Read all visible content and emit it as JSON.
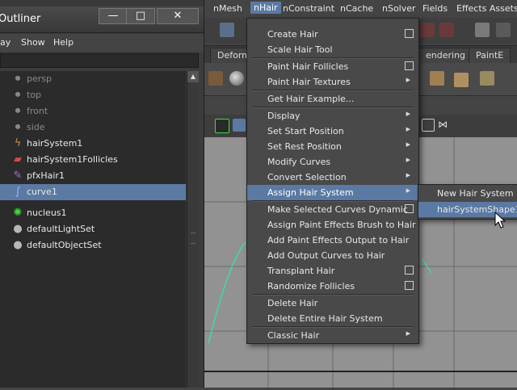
{
  "outliner": {
    "title": "Outliner",
    "window_buttons": {
      "minimize": "—",
      "maximize": "□",
      "close": "✕"
    },
    "menus": [
      "Display",
      "Show",
      "Help"
    ],
    "menus_visible": [
      "ay",
      "Show",
      "Help"
    ],
    "items": [
      {
        "label": "persp",
        "icon": "camera-icon",
        "dim": true
      },
      {
        "label": "top",
        "icon": "camera-icon",
        "dim": true
      },
      {
        "label": "front",
        "icon": "camera-icon",
        "dim": true
      },
      {
        "label": "side",
        "icon": "camera-icon",
        "dim": true
      },
      {
        "label": "hairSystem1",
        "icon": "hair-system-icon",
        "dim": false
      },
      {
        "label": "hairSystem1Follicles",
        "icon": "follicles-icon",
        "dim": false
      },
      {
        "label": "pfxHair1",
        "icon": "pfx-hair-icon",
        "dim": false
      },
      {
        "label": "curve1",
        "icon": "curve-icon",
        "dim": false,
        "selected": true
      },
      {
        "label": "nucleus1",
        "icon": "nucleus-icon",
        "dim": false
      },
      {
        "label": "defaultLightSet",
        "icon": "set-icon",
        "dim": false
      },
      {
        "label": "defaultObjectSet",
        "icon": "set-icon",
        "dim": false
      }
    ]
  },
  "main_menubar": {
    "items": [
      "nMesh",
      "nHair",
      "nConstraint",
      "nCache",
      "nSolver",
      "Fields",
      "Effects Assets"
    ],
    "active": "nHair"
  },
  "shelf_tabs": [
    "Deform",
    "endering",
    "PaintE"
  ],
  "nhair_menu": {
    "items": [
      {
        "label": "Create Hair",
        "option_box": true
      },
      {
        "label": "Scale Hair Tool"
      },
      {
        "sep": true
      },
      {
        "label": "Paint Hair Follicles",
        "option_box": true
      },
      {
        "label": "Paint Hair Textures",
        "submenu": true
      },
      {
        "sep": true
      },
      {
        "label": "Get Hair Example..."
      },
      {
        "sep": true
      },
      {
        "label": "Display",
        "submenu": true
      },
      {
        "label": "Set Start Position",
        "submenu": true
      },
      {
        "label": "Set Rest Position",
        "submenu": true
      },
      {
        "label": "Modify Curves",
        "submenu": true
      },
      {
        "label": "Convert Selection",
        "submenu": true
      },
      {
        "label": "Assign Hair System",
        "submenu": true,
        "highlight": true
      },
      {
        "sep": true
      },
      {
        "label": "Make Selected Curves Dynamic",
        "option_box": true
      },
      {
        "label": "Assign Paint Effects Brush to Hair"
      },
      {
        "label": "Add Paint Effects Output to Hair"
      },
      {
        "label": "Add Output Curves to Hair"
      },
      {
        "label": "Transplant Hair",
        "option_box": true
      },
      {
        "label": "Randomize Follicles",
        "option_box": true
      },
      {
        "sep": true
      },
      {
        "label": "Delete Hair"
      },
      {
        "label": "Delete Entire Hair System"
      },
      {
        "sep": true
      },
      {
        "label": "Classic Hair",
        "submenu": true
      }
    ]
  },
  "assign_submenu": {
    "items": [
      {
        "label": "New Hair System"
      },
      {
        "label": "hairSystemShape1",
        "highlight": true
      }
    ]
  },
  "colors": {
    "highlight": "#5b7aa3",
    "menu_bg": "#494949",
    "outliner_bg": "#2b2b2b",
    "viewport_bg": "#929292",
    "curve": "#3fdc9a"
  }
}
